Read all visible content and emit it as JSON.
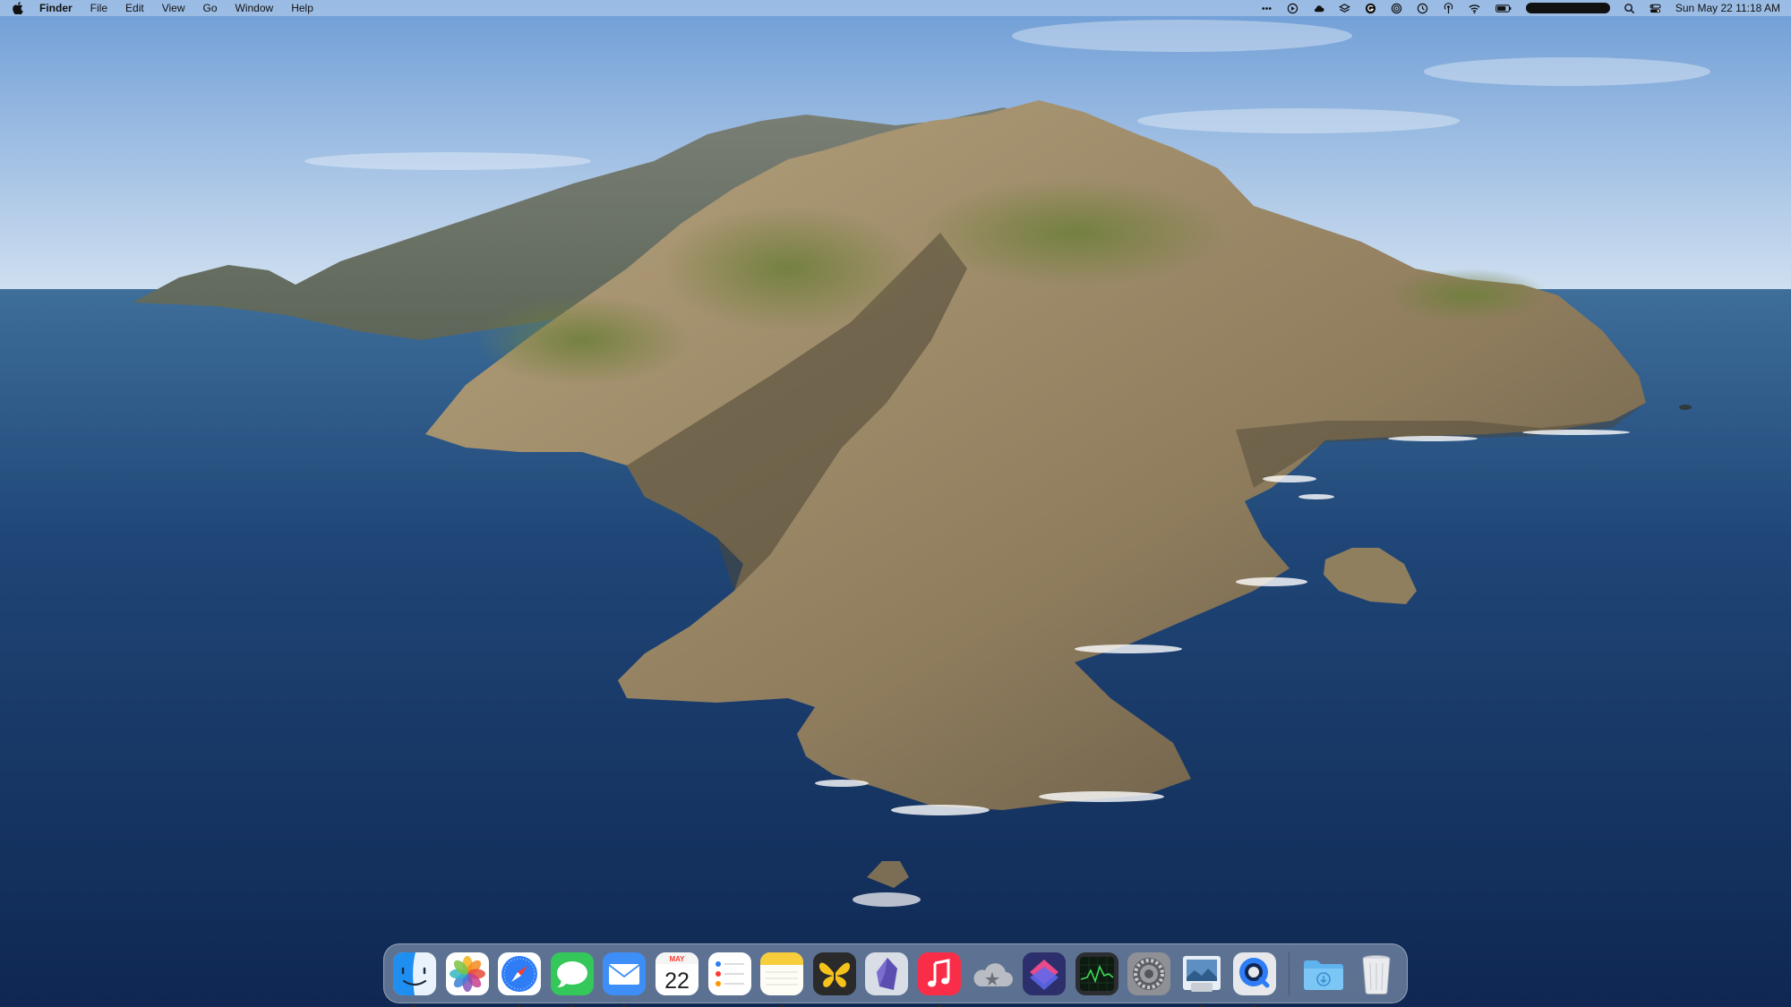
{
  "menubar": {
    "app_name": "Finder",
    "menus": [
      "File",
      "Edit",
      "View",
      "Go",
      "Window",
      "Help"
    ],
    "status_icons": [
      "more-icon",
      "play-icon",
      "cloud-icon",
      "layers-icon",
      "grammarly-icon",
      "fingerprint-icon",
      "time-machine-icon",
      "airdrop-icon",
      "wifi-icon",
      "battery-icon",
      "spotlight-icon",
      "control-center-icon"
    ],
    "clock": "Sun May 22  11:18 AM"
  },
  "dock": {
    "apps": [
      {
        "name": "finder",
        "running": true
      },
      {
        "name": "photos",
        "running": false
      },
      {
        "name": "safari",
        "running": true
      },
      {
        "name": "messages",
        "running": true
      },
      {
        "name": "mail",
        "running": true
      },
      {
        "name": "calendar",
        "running": false
      },
      {
        "name": "reminders",
        "running": false
      },
      {
        "name": "notes",
        "running": true
      },
      {
        "name": "tes",
        "running": false
      },
      {
        "name": "obsidian",
        "running": false
      },
      {
        "name": "music",
        "running": true
      },
      {
        "name": "cloud-app",
        "running": false
      },
      {
        "name": "shortcuts",
        "running": false
      },
      {
        "name": "activity-monitor",
        "running": false
      },
      {
        "name": "system-preferences",
        "running": false
      },
      {
        "name": "preview",
        "running": true
      },
      {
        "name": "quicktime",
        "running": true
      }
    ],
    "calendar": {
      "month": "MAY",
      "day": "22"
    },
    "stacks": [
      {
        "name": "downloads"
      },
      {
        "name": "trash"
      }
    ]
  },
  "colors": {
    "sky_top": "#6e9dd6",
    "sky_horizon": "#cfdff0",
    "ocean_far": "#3e6e9a",
    "ocean_near": "#102a55",
    "accent": "#2e7cf6"
  }
}
